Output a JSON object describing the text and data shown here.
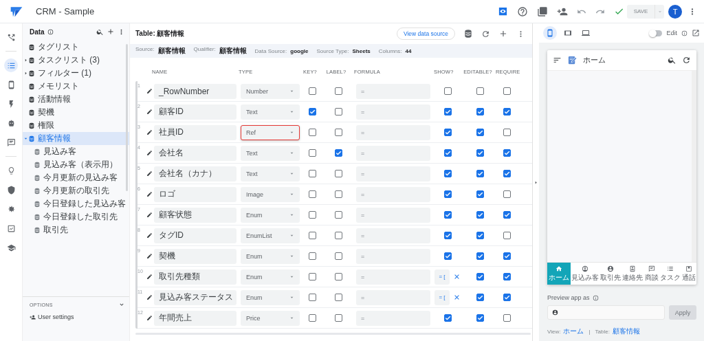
{
  "app": {
    "title": "CRM - Sample",
    "avatar": "T",
    "save": "SAVE",
    "save_disabled": true
  },
  "rail": [
    {
      "selected": false
    },
    {
      "selected": true
    },
    {
      "selected": false
    },
    {
      "selected": false
    },
    {
      "selected": false
    },
    {
      "selected": false
    },
    {
      "selected": false
    },
    {
      "selected": false
    },
    {
      "selected": false
    },
    {
      "selected": false
    },
    {
      "selected": false
    }
  ],
  "sidebar": {
    "title": "Data",
    "items": [
      {
        "label": "タグリスト",
        "selected": false
      },
      {
        "label": "タスクリスト (3)",
        "selected": false,
        "expanded": false
      },
      {
        "label": "フィルター (1)",
        "selected": false,
        "expanded": false
      },
      {
        "label": "メモリスト",
        "selected": false
      },
      {
        "label": "活動情報",
        "selected": false
      },
      {
        "label": "契機",
        "selected": false
      },
      {
        "label": "権限",
        "selected": false
      },
      {
        "label": "顧客情報",
        "selected": true,
        "expanded": true,
        "children": [
          {
            "label": "見込み客",
            "selected": false
          },
          {
            "label": "見込み客（表示用）",
            "selected": false
          },
          {
            "label": "今月更新の見込み客",
            "selected": false
          },
          {
            "label": "今月更新の取引先",
            "selected": false
          },
          {
            "label": "今日登録した見込み客",
            "selected": false
          },
          {
            "label": "今日登録した取引先",
            "selected": false
          },
          {
            "label": "取引先",
            "selected": false
          }
        ]
      }
    ],
    "options_label": "OPTIONS",
    "user_settings": "User settings"
  },
  "table": {
    "title": "Table: 顧客情報",
    "view_source": "View data source",
    "info": [
      {
        "label": "Source:",
        "value": "顧客情報"
      },
      {
        "label": "Qualifier:",
        "value": "顧客情報"
      },
      {
        "label": "Data Source:",
        "value": "google"
      },
      {
        "label": "Source Type:",
        "value": "Sheets"
      },
      {
        "label": "Columns:",
        "value": "44"
      }
    ],
    "columns": [
      "NAME",
      "TYPE",
      "KEY?",
      "LABEL?",
      "FORMULA",
      "SHOW?",
      "EDITABLE?",
      "REQUIRE"
    ],
    "rows": [
      {
        "num": "1",
        "name": "_RowNumber",
        "type": "Number",
        "highlighted": false,
        "key": false,
        "label": false,
        "formula": "=",
        "show": {
          "kind": "checkbox",
          "checked": false
        },
        "editable": false,
        "required": false
      },
      {
        "num": "2",
        "name": "顧客ID",
        "type": "Text",
        "highlighted": false,
        "key": true,
        "label": false,
        "formula": "=",
        "show": {
          "kind": "checkbox",
          "checked": true
        },
        "editable": true,
        "required": true
      },
      {
        "num": "3",
        "name": "社員ID",
        "type": "Ref",
        "highlighted": true,
        "key": false,
        "label": false,
        "formula": "=",
        "show": {
          "kind": "checkbox",
          "checked": true
        },
        "editable": true,
        "required": false
      },
      {
        "num": "4",
        "name": "会社名",
        "type": "Text",
        "highlighted": false,
        "key": false,
        "label": true,
        "formula": "=",
        "show": {
          "kind": "checkbox",
          "checked": true
        },
        "editable": true,
        "required": true
      },
      {
        "num": "5",
        "name": "会社名（カナ）",
        "type": "Text",
        "highlighted": false,
        "key": false,
        "label": false,
        "formula": "=",
        "show": {
          "kind": "checkbox",
          "checked": true
        },
        "editable": true,
        "required": true
      },
      {
        "num": "6",
        "name": "ロゴ",
        "type": "Image",
        "highlighted": false,
        "key": false,
        "label": false,
        "formula": "=",
        "show": {
          "kind": "checkbox",
          "checked": true
        },
        "editable": true,
        "required": false
      },
      {
        "num": "7",
        "name": "顧客状態",
        "type": "Enum",
        "highlighted": false,
        "key": false,
        "label": false,
        "formula": "=",
        "show": {
          "kind": "checkbox",
          "checked": true
        },
        "editable": true,
        "required": true
      },
      {
        "num": "8",
        "name": "タグID",
        "type": "EnumList",
        "highlighted": false,
        "key": false,
        "label": false,
        "formula": "=",
        "show": {
          "kind": "checkbox",
          "checked": true
        },
        "editable": true,
        "required": false
      },
      {
        "num": "9",
        "name": "契機",
        "type": "Enum",
        "highlighted": false,
        "key": false,
        "label": false,
        "formula": "=",
        "show": {
          "kind": "checkbox",
          "checked": true
        },
        "editable": true,
        "required": true
      },
      {
        "num": "10",
        "name": "取引先種類",
        "type": "Enum",
        "highlighted": false,
        "key": false,
        "label": false,
        "formula": "=",
        "show": {
          "kind": "formula",
          "value": "= ["
        },
        "editable": true,
        "required": true
      },
      {
        "num": "11",
        "name": "見込み客ステータス",
        "type": "Enum",
        "highlighted": false,
        "key": false,
        "label": false,
        "formula": "=",
        "show": {
          "kind": "formula",
          "value": "= ["
        },
        "editable": true,
        "required": true
      },
      {
        "num": "12",
        "name": "年間売上",
        "type": "Price",
        "highlighted": false,
        "key": false,
        "label": false,
        "formula": "=",
        "show": {
          "kind": "checkbox",
          "checked": true
        },
        "editable": true,
        "required": false
      }
    ]
  },
  "preview": {
    "devices": [
      {
        "selected": true
      },
      {
        "selected": false
      },
      {
        "selected": false
      }
    ],
    "edit_label": "Edit",
    "edit_on": false,
    "screen_title": "ホーム",
    "nav": [
      {
        "label": "ホーム",
        "selected": true
      },
      {
        "label": "見込み客",
        "selected": false
      },
      {
        "label": "取引先",
        "selected": false
      },
      {
        "label": "連絡先",
        "selected": false
      },
      {
        "label": "商談",
        "selected": false
      },
      {
        "label": "タスク",
        "selected": false
      },
      {
        "label": "通話",
        "selected": false
      }
    ],
    "preview_as": "Preview app as",
    "apply": "Apply",
    "apply_disabled": true,
    "view_label": "View:",
    "view_value": "ホーム",
    "separator": "|",
    "table_label": "Table:",
    "table_value": "顧客情報"
  }
}
